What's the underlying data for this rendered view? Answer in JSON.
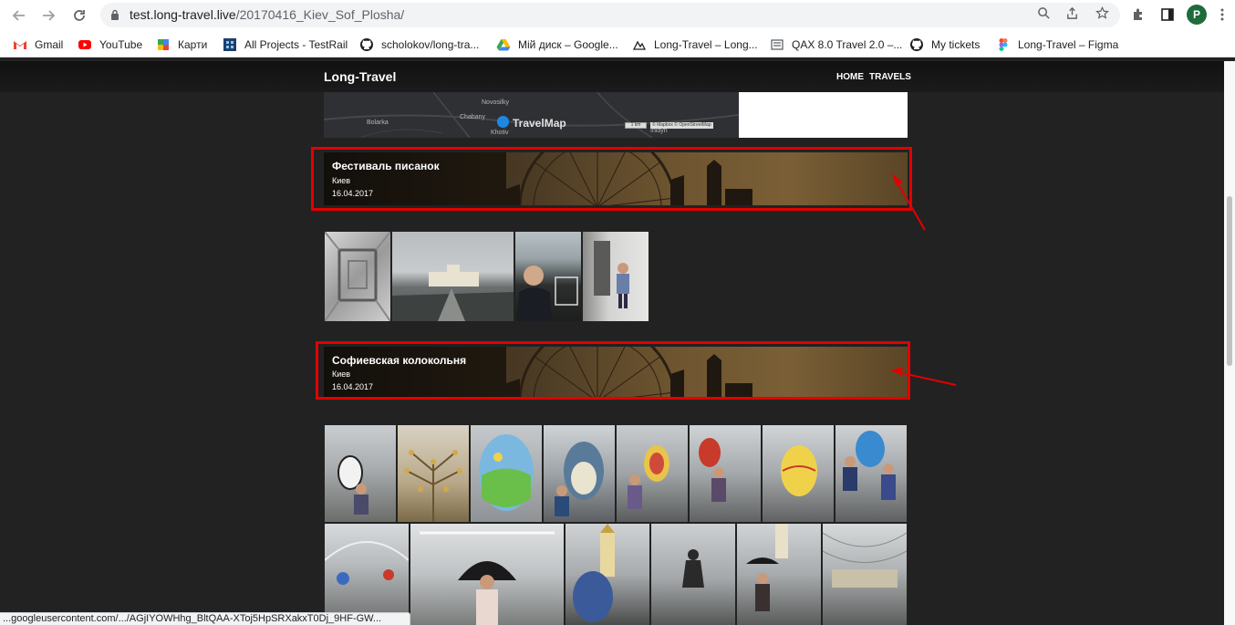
{
  "browser": {
    "url_host": "test.long-travel.live",
    "url_path": "/20170416_Kiev_Sof_Plosha/",
    "profile_initial": "P",
    "bookmarks": [
      {
        "label": "Gmail",
        "icon": "gmail-icon"
      },
      {
        "label": "YouTube",
        "icon": "youtube-icon"
      },
      {
        "label": "Карти",
        "icon": "maps-icon"
      },
      {
        "label": "All Projects - TestRail",
        "icon": "testrail-icon"
      },
      {
        "label": "scholokov/long-tra...",
        "icon": "github-icon"
      },
      {
        "label": "Мій диск – Google...",
        "icon": "google-drive-icon"
      },
      {
        "label": "Long-Travel – Long...",
        "icon": "long-travel-icon"
      },
      {
        "label": "QAX 8.0 Travel 2.0 –...",
        "icon": "qax-icon"
      },
      {
        "label": "My tickets",
        "icon": "github-icon"
      },
      {
        "label": "Long-Travel – Figma",
        "icon": "figma-icon"
      }
    ]
  },
  "site": {
    "logo": "Long-Travel",
    "nav": [
      "HOME",
      "TRAVELS"
    ]
  },
  "map": {
    "labels": [
      "Novosilky",
      "Chabany",
      "Bolarka",
      "Khotiv",
      "Inidyn"
    ],
    "brand": "TravelMap",
    "scale": "1 km",
    "attribution": "© Mapbox © OpenStreetMap"
  },
  "sections": [
    {
      "title": "Фестиваль писанок",
      "city": "Киев",
      "date": "16.04.2017"
    },
    {
      "title": "Софиевская колокольня",
      "city": "Киев",
      "date": "16.04.2017"
    }
  ],
  "status_bar": "...googleusercontent.com/.../AGjIYOWHhg_BltQAA-XToj5HpSRXakxT0Dj_9HF-GW...",
  "colors": {
    "highlight": "#e30000",
    "page_bg": "#222222"
  }
}
